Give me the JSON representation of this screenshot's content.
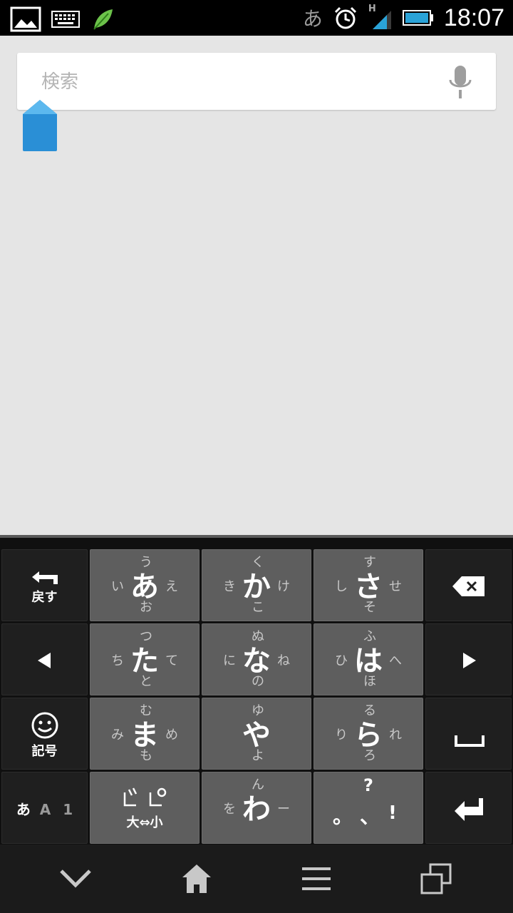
{
  "status_bar": {
    "ime_indicator": "あ",
    "time": "18:07",
    "network_type": "H",
    "icons": [
      "image-icon",
      "keyboard-icon",
      "leaf-icon",
      "alarm-icon",
      "signal-icon",
      "battery-icon"
    ]
  },
  "search": {
    "placeholder": "検索",
    "value": ""
  },
  "keyboard": {
    "back_label": "戻す",
    "symbols_label": "記号",
    "mode_label_kana": "あ",
    "mode_label_alpha": "A",
    "mode_label_num": "1",
    "dakuten_label": "大⇔小",
    "rows": [
      [
        {
          "main": "あ",
          "up": "う",
          "left": "い",
          "right": "え",
          "down": "お"
        },
        {
          "main": "か",
          "up": "く",
          "left": "き",
          "right": "け",
          "down": "こ"
        },
        {
          "main": "さ",
          "up": "す",
          "left": "し",
          "right": "せ",
          "down": "そ"
        }
      ],
      [
        {
          "main": "た",
          "up": "つ",
          "left": "ち",
          "right": "て",
          "down": "と"
        },
        {
          "main": "な",
          "up": "ぬ",
          "left": "に",
          "right": "ね",
          "down": "の"
        },
        {
          "main": "は",
          "up": "ふ",
          "left": "ひ",
          "right": "へ",
          "down": "ほ"
        }
      ],
      [
        {
          "main": "ま",
          "up": "む",
          "left": "み",
          "right": "め",
          "down": "も"
        },
        {
          "main": "や",
          "up": "ゆ",
          "left": "",
          "right": "",
          "down": "よ"
        },
        {
          "main": "ら",
          "up": "る",
          "left": "り",
          "right": "れ",
          "down": "ろ"
        }
      ],
      [
        {
          "main": "わ",
          "up": "ん",
          "left": "を",
          "right": "ー",
          "down": ""
        }
      ]
    ],
    "punct": {
      "up": "?",
      "left": "。",
      "middle": "、",
      "right": "!"
    }
  },
  "colors": {
    "accent": "#2a8fd6",
    "keyboard_bg": "#101010",
    "kana_key": "#5e5e5e",
    "fn_key": "#1f1f1f"
  }
}
